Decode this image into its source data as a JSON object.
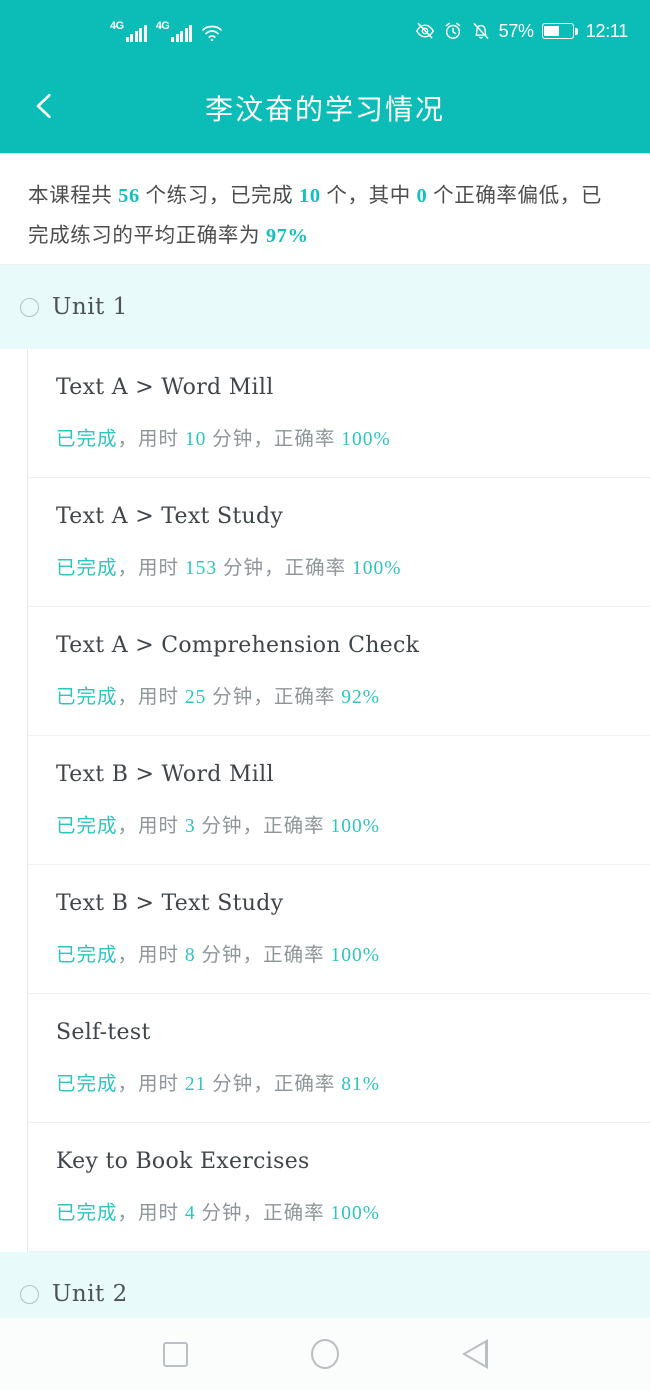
{
  "statusbar": {
    "network_1": "4G",
    "network_2": "4G",
    "wifi_icon": "wifi-icon",
    "eye_icon": "eye-off-icon",
    "alarm_icon": "alarm-clock-icon",
    "mute_icon": "bell-off-icon",
    "battery_percent": "57%",
    "battery_icon": "battery-icon",
    "time": "12:11"
  },
  "appbar": {
    "back_icon": "chevron-left-icon",
    "title": "李汶奋的学习情况"
  },
  "summary": {
    "seg1": "本课程共 ",
    "total_exercises": "56",
    "seg2": " 个练习，已完成 ",
    "completed": "10",
    "seg3": " 个，其中 ",
    "low_accuracy": "0",
    "seg4": " 个正确率偏低，已完成练习的平均正确率为 ",
    "avg_accuracy": "97%"
  },
  "status_labels": {
    "completed": "已完成",
    "sep": "，",
    "duration_prefix": "用时 ",
    "duration_suffix": " 分钟",
    "accuracy_prefix": "正确率 "
  },
  "units": [
    {
      "circle_icon": "circle-outline-icon",
      "label": "Unit 1",
      "items": [
        {
          "title": "Text A > Word Mill",
          "status": "已完成",
          "minutes": "10",
          "accuracy": "100%"
        },
        {
          "title": "Text A > Text Study",
          "status": "已完成",
          "minutes": "153",
          "accuracy": "100%"
        },
        {
          "title": "Text A > Comprehension Check",
          "status": "已完成",
          "minutes": "25",
          "accuracy": "92%"
        },
        {
          "title": "Text B > Word Mill",
          "status": "已完成",
          "minutes": "3",
          "accuracy": "100%"
        },
        {
          "title": "Text B > Text Study",
          "status": "已完成",
          "minutes": "8",
          "accuracy": "100%"
        },
        {
          "title": "Self-test",
          "status": "已完成",
          "minutes": "21",
          "accuracy": "81%"
        },
        {
          "title": "Key to Book Exercises",
          "status": "已完成",
          "minutes": "4",
          "accuracy": "100%"
        }
      ]
    },
    {
      "circle_icon": "circle-outline-icon",
      "label": "Unit 2",
      "items": []
    }
  ],
  "navbar": {
    "recents_icon": "square-recents-icon",
    "home_icon": "circle-home-icon",
    "back_icon": "triangle-back-icon"
  },
  "colors": {
    "brand_teal": "#0cbcb6",
    "accent_teal": "#2ec5be",
    "unit_bg": "#e9fafa",
    "text_primary": "#3f4548",
    "text_muted": "#8e9699"
  }
}
